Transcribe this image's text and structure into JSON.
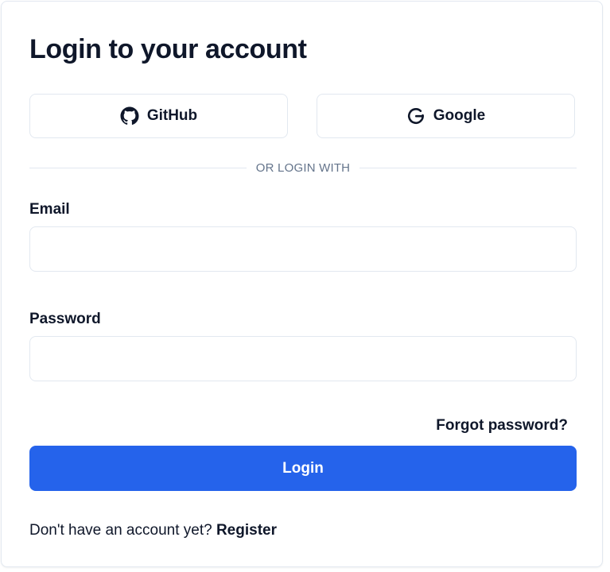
{
  "login_form": {
    "title": "Login to your account",
    "oauth": {
      "github_label": "GitHub",
      "github_icon": "github-icon",
      "google_label": "Google",
      "google_icon": "google-icon"
    },
    "divider_text": "OR LOGIN WITH",
    "email": {
      "label": "Email",
      "value": "",
      "placeholder": ""
    },
    "password": {
      "label": "Password",
      "value": "",
      "placeholder": ""
    },
    "forgot_password_label": "Forgot password?",
    "login_button_label": "Login",
    "register_prompt": "Don't have an account yet?",
    "register_link_label": "Register"
  },
  "colors": {
    "primary": "#2563eb",
    "text": "#0f172a",
    "muted": "#64748b",
    "border": "#e2e8f0"
  }
}
